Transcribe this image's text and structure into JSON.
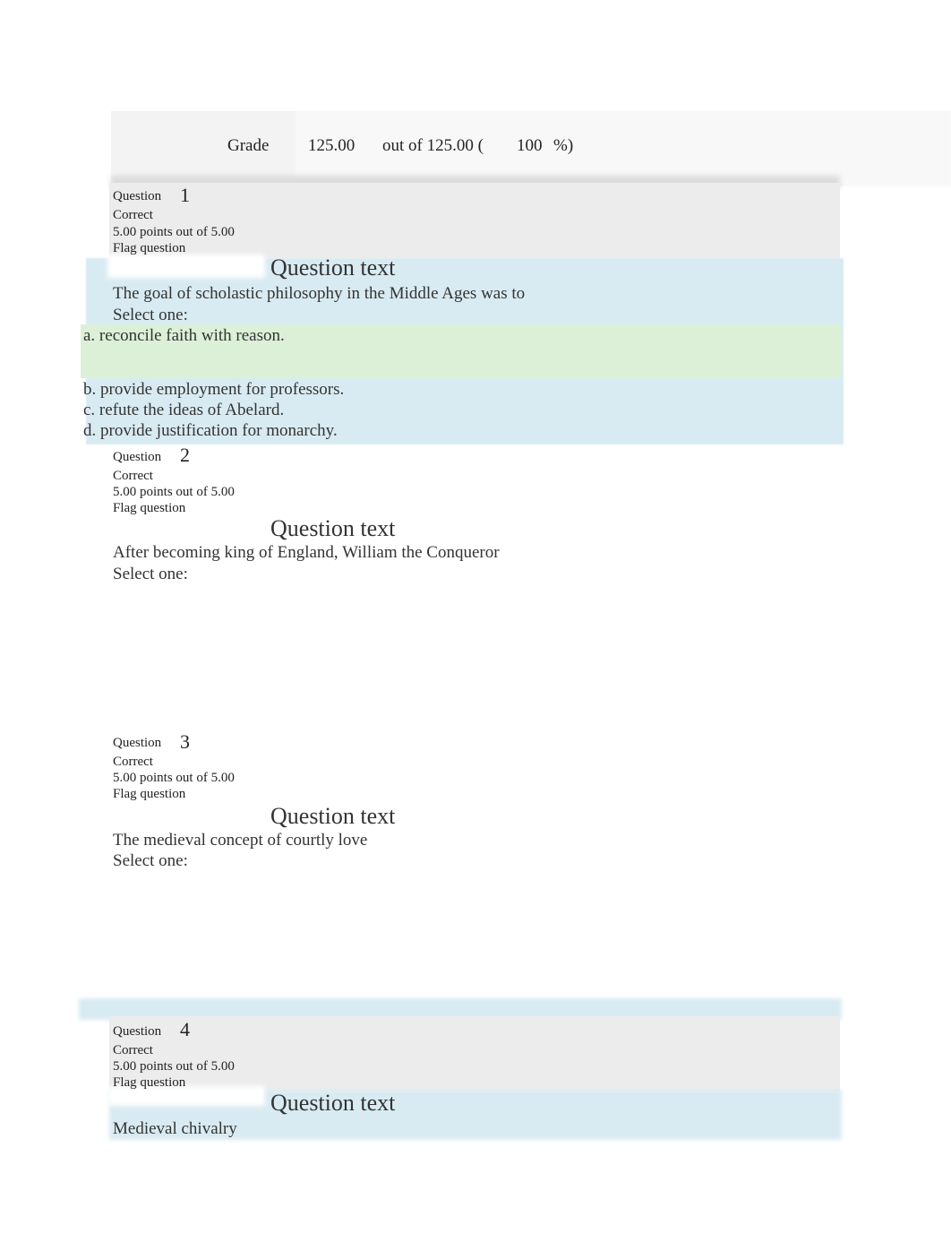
{
  "grade": {
    "label": "Grade",
    "score": "125.00",
    "out_of": "out of 125.00 (",
    "percent": "100",
    "percent_suffix": "%)"
  },
  "questions": [
    {
      "label": "Question",
      "number": "1",
      "state": "Correct",
      "points": "5.00 points out of 5.00",
      "flag": "Flag question",
      "heading": "Question text",
      "text": "The goal of scholastic philosophy in the Middle Ages was to",
      "prompt": "Select one:",
      "answers": [
        "a. reconcile faith with reason.",
        "b. provide employment for professors.",
        "c. refute the ideas of Abelard.",
        "d. provide justification for monarchy."
      ],
      "correct_index": 0
    },
    {
      "label": "Question",
      "number": "2",
      "state": "Correct",
      "points": "5.00 points out of 5.00",
      "flag": "Flag question",
      "heading": "Question text",
      "text": "After becoming king of England, William the Conqueror",
      "prompt": "Select one:"
    },
    {
      "label": "Question",
      "number": "3",
      "state": "Correct",
      "points": "5.00 points out of 5.00",
      "flag": "Flag question",
      "heading": "Question text",
      "text": "The medieval concept of courtly love",
      "prompt": "Select one:"
    },
    {
      "label": "Question",
      "number": "4",
      "state": "Correct",
      "points": "5.00 points out of 5.00",
      "flag": "Flag question",
      "heading": "Question text",
      "text": "Medieval chivalry"
    }
  ],
  "colors": {
    "info_panel": "#ececec",
    "formulation": "#d9ebf2",
    "correct_answer": "#dcf0d8",
    "grade_bar": "#f8f8f8"
  }
}
